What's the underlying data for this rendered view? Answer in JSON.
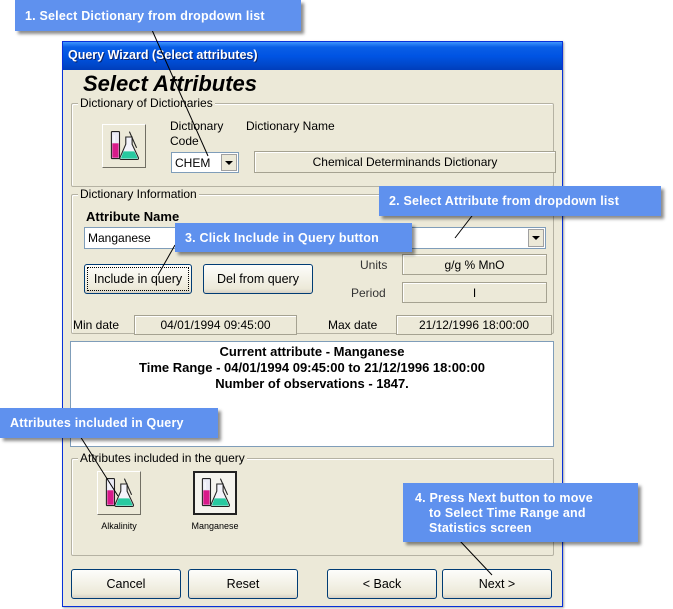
{
  "window": {
    "title": "Query Wizard (Select attributes)",
    "heading": "Select Attributes"
  },
  "dictionaries": {
    "group_title": "Dictionary of Dictionaries",
    "code_label": "Dictionary Code",
    "name_label": "Dictionary Name",
    "code_value": "CHEM",
    "name_value": "Chemical Determinands Dictionary",
    "icon": "chemistry-flask-icon"
  },
  "dictionary_info": {
    "group_title": "Dictionary Information",
    "attribute_label": "Attribute Name",
    "attribute_value": "Manganese",
    "include_button": "Include in query",
    "delete_button": "Del from query",
    "units_label": "Units",
    "units_value": "g/g % MnO",
    "period_label": "Period",
    "period_value": "I"
  },
  "dates": {
    "min_label": "Min date",
    "min_value": "04/01/1994 09:45:00",
    "max_label": "Max date",
    "max_value": "21/12/1996 18:00:00"
  },
  "info": {
    "line1": "Current attribute - Manganese",
    "line2": "Time Range - 04/01/1994 09:45:00 to 21/12/1996 18:00:00",
    "line3": "Number of observations - 1847."
  },
  "included": {
    "group_title": "Attributes included in the query",
    "items": [
      {
        "label": "Alkalinity",
        "icon": "chemistry-flask-icon"
      },
      {
        "label": "Manganese",
        "icon": "chemistry-flask-icon"
      }
    ]
  },
  "nav": {
    "cancel": "Cancel",
    "reset": "Reset",
    "back": "< Back",
    "next": "Next >"
  },
  "callouts": {
    "step1": "1. Select Dictionary from dropdown list",
    "step2": "2. Select Attribute from dropdown list",
    "step3": "3. Click Include in Query button",
    "attrs": "Attributes included in Query",
    "step4_line1": "4. Press  Next button to move",
    "step4_line2": "to Select Time Range and",
    "step4_line3": "Statistics screen"
  },
  "colors": {
    "callout_bg": "#5f91ee",
    "titlebar": "#0054e3",
    "window_bg": "#ece9d8"
  }
}
